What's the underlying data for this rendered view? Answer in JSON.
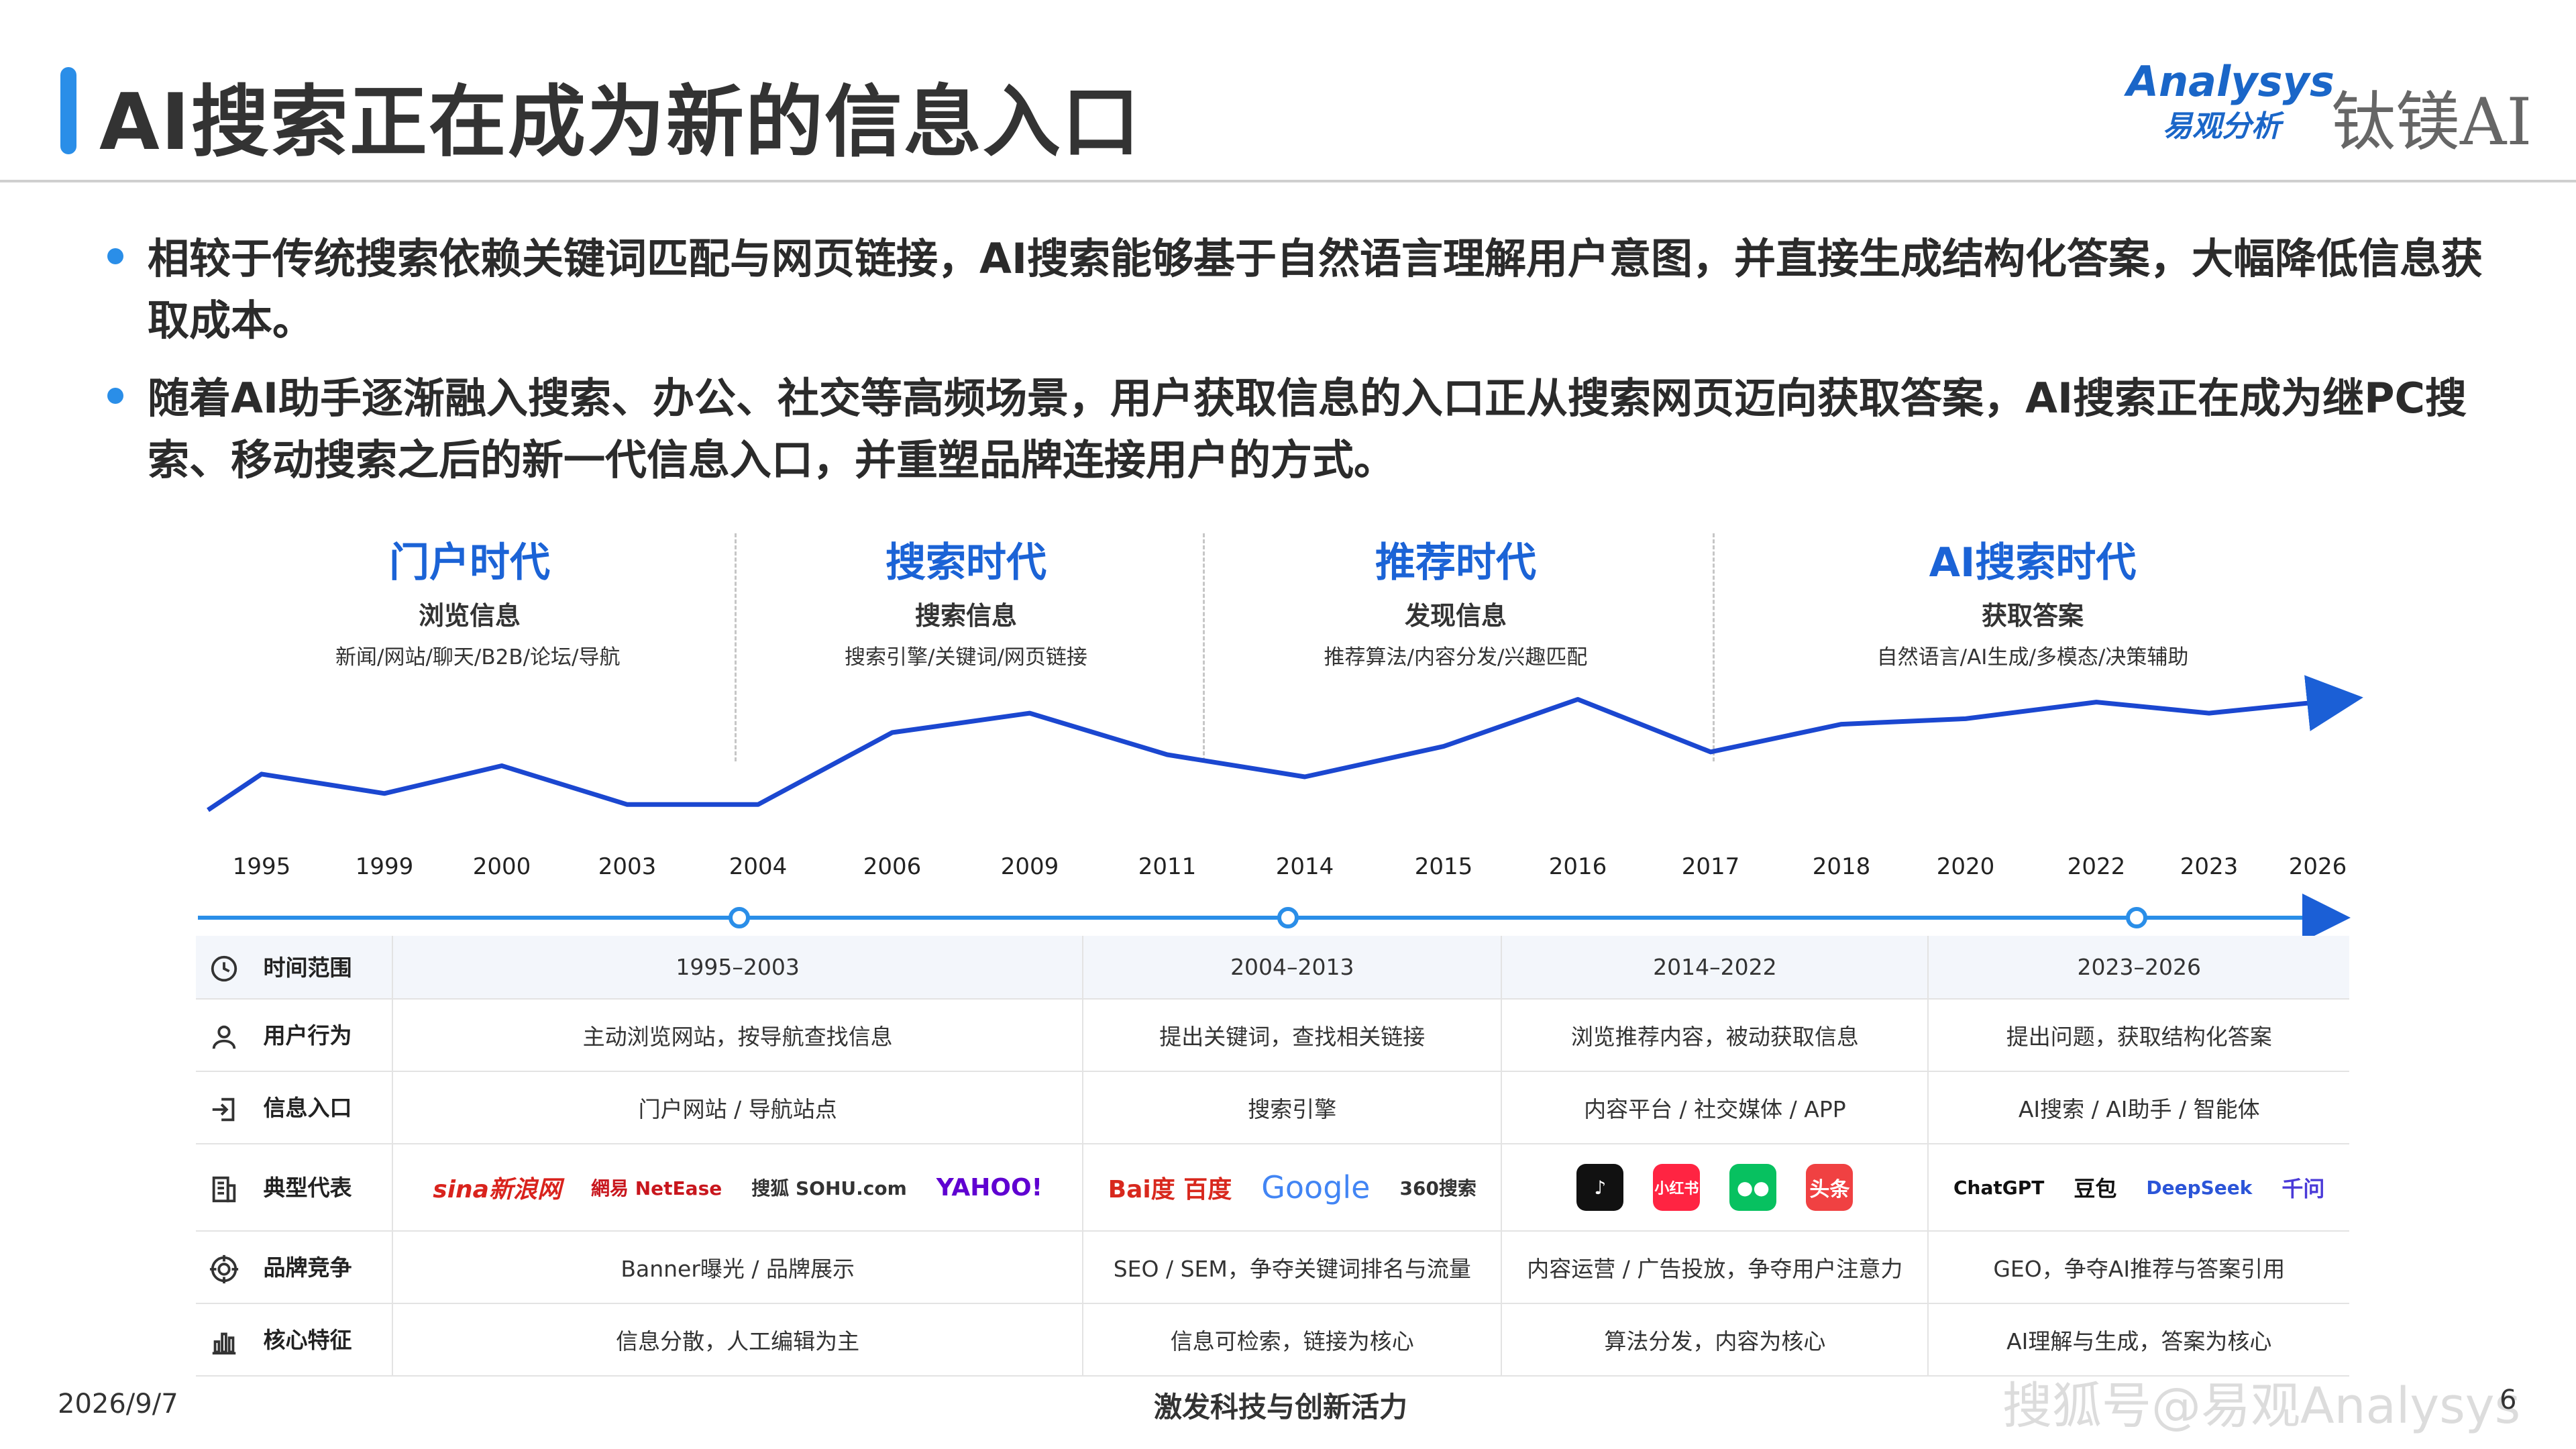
{
  "header": {
    "title": "AI搜索正在成为新的信息入口",
    "logo_en": "Analysys",
    "logo_cn": "易观分析",
    "logo_partner": "钛镁AI"
  },
  "bullets": [
    "相较于传统搜索依赖关键词匹配与网页链接，AI搜索能够基于自然语言理解用户意图，并直接生成结构化答案，大幅降低信息获取成本。",
    "随着AI助手逐渐融入搜索、办公、社交等高频场景，用户获取信息的入口正从搜索网页迈向获取答案，AI搜索正在成为继PC搜索、移动搜索之后的新一代信息入口，并重塑品牌连接用户的方式。"
  ],
  "eras": [
    {
      "name": "门户时代",
      "sub": "浏览信息",
      "desc": "新闻/网站/聊天/B2B/论坛/导航"
    },
    {
      "name": "搜索时代",
      "sub": "搜索信息",
      "desc": "搜索引擎/关键词/网页链接"
    },
    {
      "name": "推荐时代",
      "sub": "发现信息",
      "desc": "推荐算法/内容分发/兴趣匹配"
    },
    {
      "name": "AI搜索时代",
      "sub": "获取答案",
      "desc": "自然语言/AI生成/多模态/决策辅助"
    }
  ],
  "chart_data": {
    "type": "line",
    "x": [
      "1995",
      "1999",
      "2000",
      "2003",
      "2004",
      "2006",
      "2009",
      "2011",
      "2014",
      "2015",
      "2016",
      "2017",
      "2018",
      "2020",
      "2022",
      "2023",
      "2026"
    ],
    "series": [
      {
        "values": [
          2.0,
          3.3,
          2.6,
          3.6,
          2.2,
          2.2,
          4.8,
          5.5,
          4.0,
          3.2,
          4.3,
          6.0,
          4.1,
          5.1,
          5.3,
          5.9,
          5.5,
          6.0
        ]
      }
    ],
    "ylim": [
      0,
      8
    ],
    "grid": false
  },
  "timeline": {
    "x_labels": [
      "1995",
      "1999",
      "2000",
      "2003",
      "2004",
      "2006",
      "2009",
      "2011",
      "2014",
      "2015",
      "2016",
      "2017",
      "2018",
      "2020",
      "2022",
      "2023",
      "2026"
    ]
  },
  "table": {
    "rows": [
      {
        "label": "时间范围",
        "icon": "clock-icon",
        "cells": [
          "1995–2003",
          "2004–2013",
          "2014–2022",
          "2023–2026"
        ]
      },
      {
        "label": "用户行为",
        "icon": "user-icon",
        "cells": [
          "主动浏览网站，按导航查找信息",
          "提出关键词，查找相关链接",
          "浏览推荐内容，被动获取信息",
          "提出问题，获取结构化答案"
        ]
      },
      {
        "label": "信息入口",
        "icon": "login-icon",
        "cells": [
          "门户网站 / 导航站点",
          "搜索引擎",
          "内容平台 / 社交媒体 / APP",
          "AI搜索 / AI助手 / 智能体"
        ]
      },
      {
        "label": "典型代表",
        "icon": "building-icon"
      },
      {
        "label": "品牌竞争",
        "icon": "target-icon",
        "cells": [
          "Banner曝光 / 品牌展示",
          "SEO / SEM，争夺关键词排名与流量",
          "内容运营 / 广告投放，争夺用户注意力",
          "GEO，争夺AI推荐与答案引用"
        ]
      },
      {
        "label": "核心特征",
        "icon": "bar-chart-icon",
        "cells": [
          "信息分散，人工编辑为主",
          "信息可检索，链接为核心",
          "算法分发，内容为核心",
          "AI理解与生成，答案为核心"
        ]
      }
    ],
    "logos": {
      "portal": [
        "sina新浪网",
        "網易 NetEase",
        "搜狐 SOHU.com",
        "YAHOO!"
      ],
      "search": [
        "Bai度 百度",
        "Google",
        "360搜索"
      ],
      "recommend": [
        "抖音",
        "小红书",
        "微信",
        "头条"
      ],
      "ai": [
        "ChatGPT",
        "豆包",
        "DeepSeek",
        "千问"
      ]
    }
  },
  "footer": {
    "date": "2026/9/7",
    "slogan": "激发科技与创新活力",
    "watermark": "搜狐号@易观Analysys",
    "page": "6"
  }
}
